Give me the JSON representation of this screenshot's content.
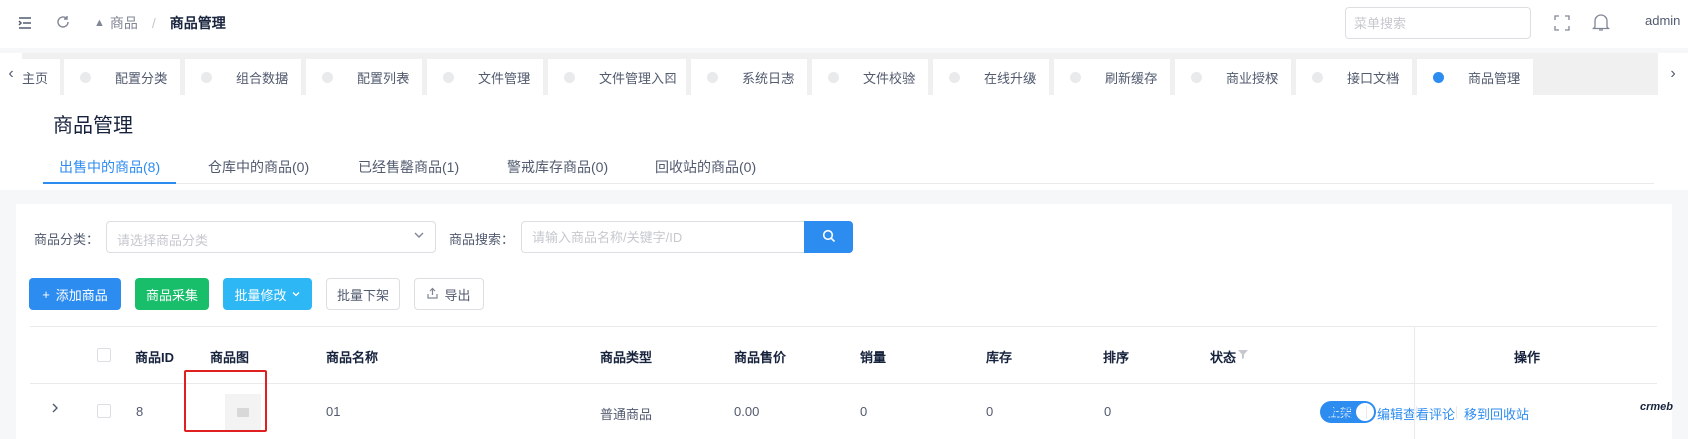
{
  "header": {
    "breadcrumb": [
      "商品",
      "商品管理"
    ],
    "search_placeholder": "菜单搜索",
    "user": "admin",
    "icons": [
      "menu-fold-icon",
      "refresh-icon",
      "fullscreen-icon",
      "bell-icon"
    ]
  },
  "tagbar": {
    "tags": [
      "主页",
      "配置分类",
      "组合数据",
      "配置列表",
      "文件管理",
      "文件管理入口",
      "系统日志",
      "文件校验",
      "在线升级",
      "刷新缓存",
      "商业授权",
      "接口文档",
      "商品管理"
    ],
    "active": "商品管理"
  },
  "page": {
    "title": "商品管理",
    "tabs": [
      "出售中的商品(8)",
      "仓库中的商品(0)",
      "已经售罄商品(1)",
      "警戒库存商品(0)",
      "回收站的商品(0)"
    ]
  },
  "filters": {
    "category_label": "商品分类：",
    "category_placeholder": "请选择商品分类",
    "search_label": "商品搜索：",
    "search_placeholder": "请输入商品名称/关键字/ID"
  },
  "buttons": {
    "add": "添加商品",
    "collect": "商品采集",
    "batch_edit": "批量修改",
    "batch_off": "批量下架",
    "export": "导出"
  },
  "table": {
    "columns": [
      "商品ID",
      "商品图",
      "商品名称",
      "商品类型",
      "商品售价",
      "销量",
      "库存",
      "排序",
      "状态",
      "操作"
    ],
    "rows": [
      {
        "id": "8",
        "name": "01",
        "type": "普通商品",
        "price": "0.00",
        "sales": "0",
        "stock": "0",
        "sort": "0",
        "status": "上架",
        "actions": [
          "查看",
          "编辑",
          "查看评论",
          "移到回收站"
        ]
      }
    ]
  },
  "brand": "crmeb",
  "colors": {
    "primary": "#2d8cf0",
    "success": "#19be6b",
    "info": "#2db7f5",
    "highlight": "#e02020"
  }
}
